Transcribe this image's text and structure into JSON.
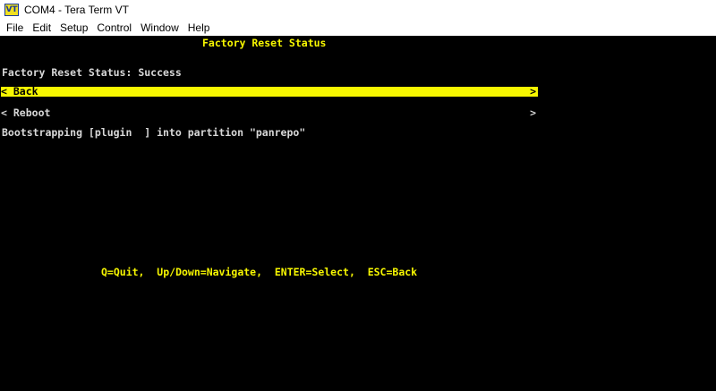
{
  "window": {
    "title": "COM4 - Tera Term VT",
    "icon_label": "VT"
  },
  "menubar": {
    "items": [
      "File",
      "Edit",
      "Setup",
      "Control",
      "Window",
      "Help"
    ]
  },
  "terminal": {
    "header": "Factory Reset Status",
    "status_line": "Factory Reset Status: Success",
    "menu_items": [
      {
        "left_glyph": "<",
        "label": "Back",
        "right_glyph": ">",
        "selected": true
      },
      {
        "left_glyph": "<",
        "label": "Reboot",
        "right_glyph": ">",
        "selected": false
      }
    ],
    "bootstrap_line": "Bootstrapping [plugin  ] into partition \"panrepo\"",
    "help_line": "Q=Quit,  Up/Down=Navigate,  ENTER=Select,  ESC=Back"
  },
  "colors": {
    "terminal_bg": "#000000",
    "highlight": "#f7f700",
    "text": "#d8d8d8"
  }
}
